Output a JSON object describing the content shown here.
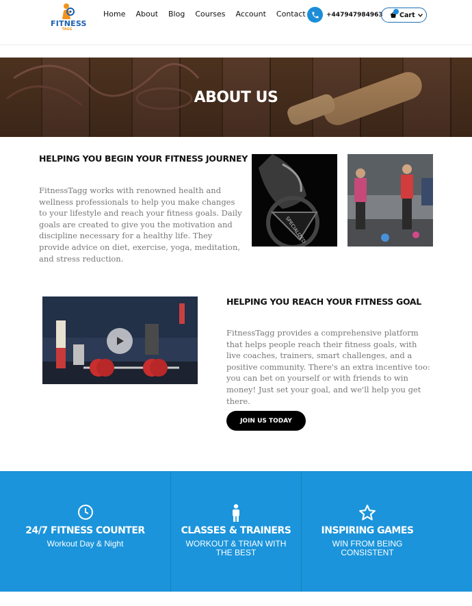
{
  "brand": {
    "logo_text": "FITNESS",
    "logo_sub": "TAGG"
  },
  "nav": {
    "items": [
      "Home",
      "About",
      "Blog",
      "Courses",
      "Account",
      "Contact"
    ]
  },
  "contact": {
    "phone": "+447947984963"
  },
  "cart": {
    "label": "Cart"
  },
  "hero": {
    "title": "ABOUT US"
  },
  "section1": {
    "title": "HELPING YOU BEGIN YOUR FITNESS JOURNEY",
    "body": "FitnessTagg works with renowned health and wellness professionals to help you make changes to your lifestyle and reach your fitness goals. Daily goals are created to give you the motivation and discipline necessary for a healthy life. They provide advice on diet, exercise, yoga, meditation, and stress reduction."
  },
  "section2": {
    "title": "HELPING YOU REACH YOUR FITNESS GOAL",
    "body": "FitnessTagg provides a comprehensive platform that helps people reach their fitness goals, with live coaches, trainers, smart challenges, and a positive community. There's an extra incentive too: you can bet on yourself or with friends to win money! Just set your goal, and we'll help you get there.",
    "cta": "JOIN US TODAY"
  },
  "features": [
    {
      "icon": "clock-icon",
      "title": "24/7 FITNESS COUNTER",
      "subtitle": "Workout Day & Night"
    },
    {
      "icon": "person-icon",
      "title": "CLASSES & TRAINERS",
      "subtitle": "WORKOUT & TRIAN WITH THE BEST"
    },
    {
      "icon": "star-icon",
      "title": "INSPIRING GAMES",
      "subtitle": "WIN FROM BEING CONSISTENT"
    }
  ],
  "colors": {
    "accent": "#1b94db",
    "brand_blue": "#1b5fae",
    "brand_orange": "#f29320",
    "button_dark": "#000000"
  }
}
